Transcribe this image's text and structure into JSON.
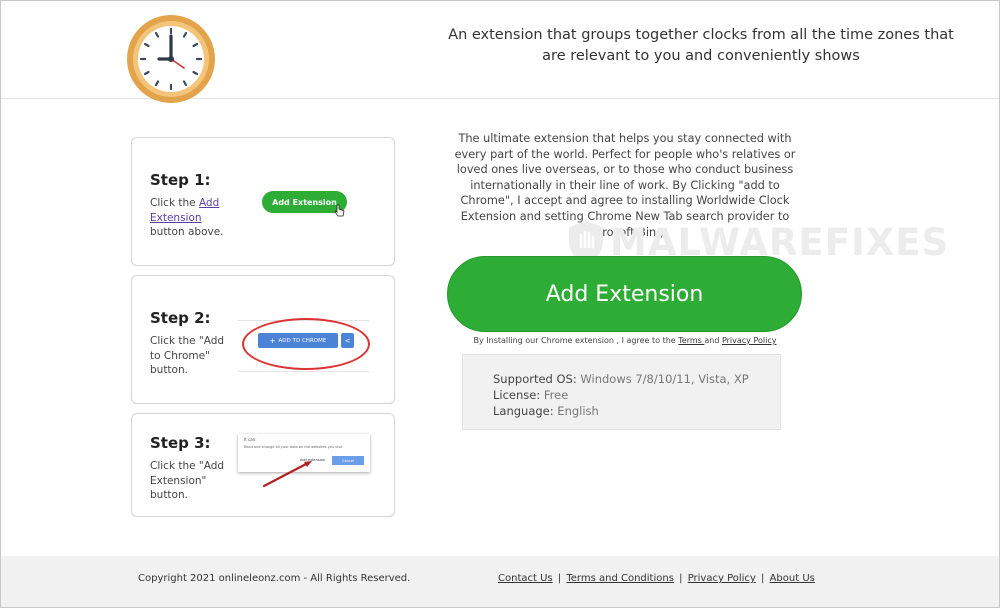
{
  "header": {
    "tagline": "An extension that groups together clocks from all the time zones that are relevant to you and conveniently shows"
  },
  "steps": [
    {
      "title": "Step 1:",
      "text_before": "Click the ",
      "link": "Add Extension",
      "text_after": " button above.",
      "button_label": "Add Extension"
    },
    {
      "title": "Step 2:",
      "text": "Click the \"Add to Chrome\" button.",
      "button_label": "ADD TO CHROME"
    },
    {
      "title": "Step 3:",
      "text": "Click the \"Add Extension\" button.",
      "dialog_title": "It can:",
      "dialog_text": "Read and change all your data on the websites you visit",
      "dialog_add": "Add extension",
      "dialog_cancel": "Cancel"
    }
  ],
  "main": {
    "intro": "The ultimate extension that helps you stay connected with every part of the world. Perfect for people who's relatives or loved ones live overseas, or to those who conduct business internationally in their line of work. By Clicking \"add to Chrome\", I accept and agree to installing Worldwide Clock Extension and setting Chrome New Tab search provider to Microsoft Bing.",
    "add_button": "Add Extension",
    "consent_text": "By Installing our Chrome extension , I agree to the ",
    "terms_link": "Terms ",
    "and": "and ",
    "privacy_link": "Privacy Policy"
  },
  "info": {
    "os_label": "Supported OS:",
    "os_value": "Windows 7/8/10/11, Vista, XP",
    "license_label": "License:",
    "license_value": "Free",
    "language_label": "Language:",
    "language_value": "English"
  },
  "watermark": "MALWAREFIXES",
  "footer": {
    "copyright": "Copyright 2021 onlineleonz.com - All Rights Reserved.",
    "links": [
      "Contact Us",
      "Terms and Conditions",
      "Privacy Policy",
      "About Us"
    ],
    "separator": "|"
  },
  "colors": {
    "green": "#2dad35",
    "chrome_blue": "#4d83d6",
    "highlight_red": "#d33",
    "clock_rim": "#e2a34a"
  }
}
